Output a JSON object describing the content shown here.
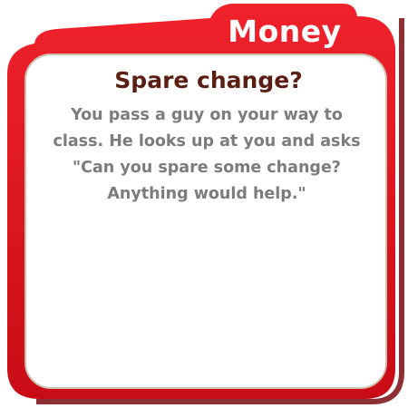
{
  "card": {
    "category": "Money",
    "title": "Spare change?",
    "body_lines": [
      "You pass a guy on your way to",
      "class. He looks up at you and asks",
      "\"Can you spare some change?",
      "Anything would help.\""
    ]
  },
  "colors": {
    "frame_red": "#e3101b",
    "frame_shadow": "#8a0a10",
    "panel_fill": "#ffffff",
    "panel_border": "#cdbfae",
    "title_color": "#5a1e12",
    "body_color": "#7c7c7c",
    "category_color": "#ffffff"
  }
}
